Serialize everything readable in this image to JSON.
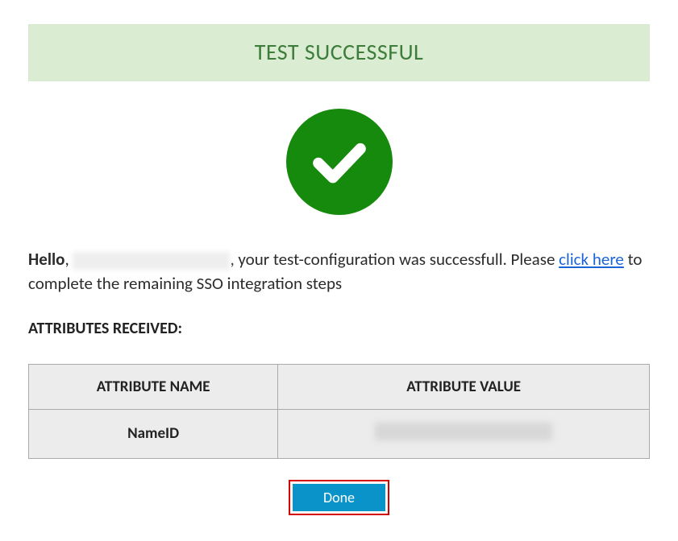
{
  "banner": {
    "title": "TEST SUCCESSFUL"
  },
  "icon": {
    "name": "checkmark-icon"
  },
  "message": {
    "hello": "Hello",
    "name_redacted": "",
    "after_name": ", your test-configuration was successfull. Please ",
    "link_text": "click here",
    "after_link": " to complete the remaining SSO integration steps"
  },
  "attributes": {
    "heading": "ATTRIBUTES RECEIVED:",
    "columns": [
      "ATTRIBUTE NAME",
      "ATTRIBUTE VALUE"
    ],
    "rows": [
      {
        "name": "NameID",
        "value": ""
      }
    ]
  },
  "done_button": {
    "label": "Done"
  }
}
